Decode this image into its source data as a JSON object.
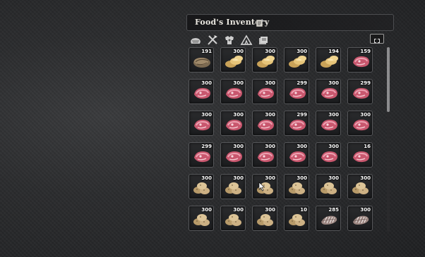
{
  "window": {
    "title": "Food's Inventory",
    "title_icon": "notepad-icon"
  },
  "tabs": [
    {
      "icon": "stone-icon"
    },
    {
      "icon": "tools-icon"
    },
    {
      "icon": "armor-icon"
    },
    {
      "icon": "camp-icon"
    },
    {
      "icon": "stack-icon"
    }
  ],
  "resize_icon": "resize-icon",
  "scroll": {
    "position": 0.0,
    "visible_fraction": 0.35
  },
  "rows": [
    [
      {
        "item": "mushroom",
        "qty": "191"
      },
      {
        "item": "bread",
        "qty": "300"
      },
      {
        "item": "bread",
        "qty": "300"
      },
      {
        "item": "bread",
        "qty": "300"
      },
      {
        "item": "bread",
        "qty": "194"
      },
      {
        "item": "meat",
        "qty": "159"
      }
    ],
    [
      {
        "item": "meat",
        "qty": "300"
      },
      {
        "item": "meat",
        "qty": "300"
      },
      {
        "item": "meat",
        "qty": "300"
      },
      {
        "item": "meat",
        "qty": "299"
      },
      {
        "item": "meat",
        "qty": "300"
      },
      {
        "item": "meat",
        "qty": "299"
      }
    ],
    [
      {
        "item": "meat",
        "qty": "300"
      },
      {
        "item": "meat",
        "qty": "300"
      },
      {
        "item": "meat",
        "qty": "300"
      },
      {
        "item": "meat",
        "qty": "299"
      },
      {
        "item": "meat",
        "qty": "300"
      },
      {
        "item": "meat",
        "qty": "300"
      }
    ],
    [
      {
        "item": "meat",
        "qty": "299"
      },
      {
        "item": "meat",
        "qty": "300"
      },
      {
        "item": "meat",
        "qty": "300"
      },
      {
        "item": "meat",
        "qty": "300"
      },
      {
        "item": "meat",
        "qty": "300"
      },
      {
        "item": "meat",
        "qty": "16"
      }
    ],
    [
      {
        "item": "potato",
        "qty": "300"
      },
      {
        "item": "potato",
        "qty": "300"
      },
      {
        "item": "potato",
        "qty": "300"
      },
      {
        "item": "potato",
        "qty": "300"
      },
      {
        "item": "potato",
        "qty": "300"
      },
      {
        "item": "potato",
        "qty": "300"
      }
    ],
    [
      {
        "item": "potato",
        "qty": "300"
      },
      {
        "item": "potato",
        "qty": "300"
      },
      {
        "item": "potato",
        "qty": "300"
      },
      {
        "item": "potato",
        "qty": "10"
      },
      {
        "item": "fish",
        "qty": "285"
      },
      {
        "item": "fish",
        "qty": "300"
      }
    ]
  ]
}
